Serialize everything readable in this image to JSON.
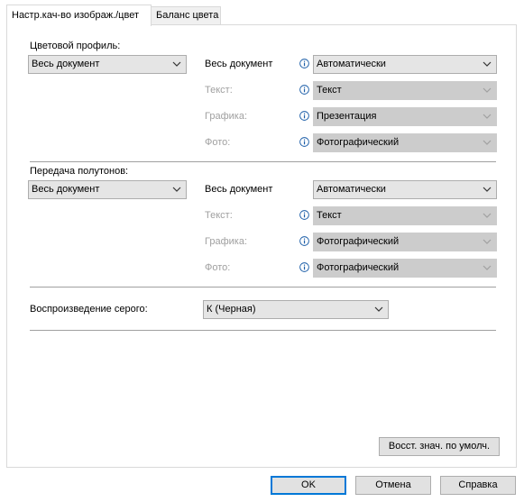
{
  "tabs": [
    {
      "label": "Настр.кач-во изображ./цвет"
    },
    {
      "label": "Баланс цвета"
    }
  ],
  "color_profile": {
    "heading": "Цветовой профиль:",
    "scope_select": "Весь документ",
    "all_label": "Весь документ",
    "all_value": "Автоматически",
    "text_label": "Текст:",
    "text_value": "Текст",
    "graphics_label": "Графика:",
    "graphics_value": "Презентация",
    "photo_label": "Фото:",
    "photo_value": "Фотографический"
  },
  "halftone": {
    "heading": "Передача полутонов:",
    "scope_select": "Весь документ",
    "all_label": "Весь документ",
    "all_value": "Автоматически",
    "text_label": "Текст:",
    "text_value": "Текст",
    "graphics_label": "Графика:",
    "graphics_value": "Фотографический",
    "photo_label": "Фото:",
    "photo_value": "Фотографический"
  },
  "gray": {
    "label": "Воспроизведение серого:",
    "value": "К (Черная)"
  },
  "restore_button": "Восст. знач. по умолч.",
  "footer": {
    "ok": "OK",
    "cancel": "Отмена",
    "help": "Справка"
  },
  "colors": {
    "accent": "#0078d7",
    "info_icon": "#1c5ea8",
    "disabled_text": "#a0a0a0",
    "disabled_field": "#cccccc"
  }
}
